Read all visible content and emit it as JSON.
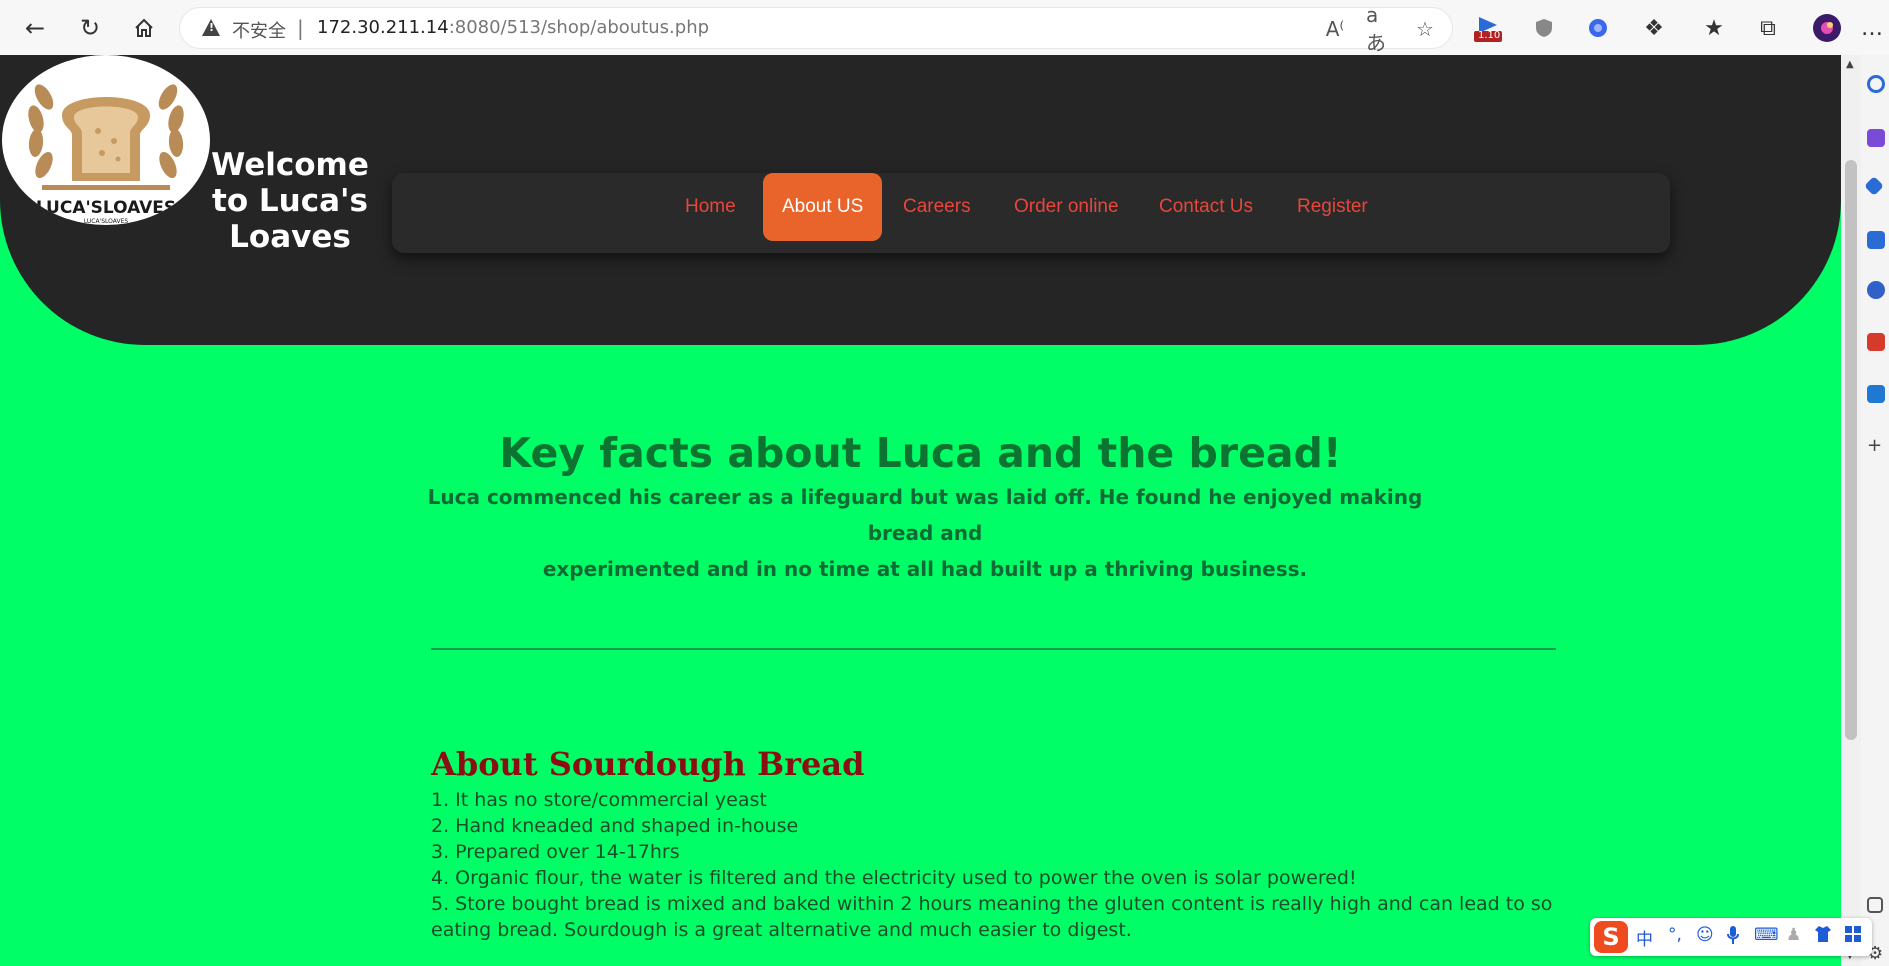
{
  "browser": {
    "insecure_label": "不安全",
    "separator": "|",
    "url_host": "172.30.211.14",
    "url_path": ":8080/513/shop/aboutus.php",
    "ext_badge": "1.10",
    "menu": "…"
  },
  "header": {
    "logo_brand": "LUCA'SLOAVES",
    "logo_sub": "LUCA'SLOAVES",
    "welcome_line1": "Welcome",
    "welcome_line2": "to Luca's",
    "welcome_line3": "Loaves"
  },
  "nav": {
    "items": [
      {
        "label": "Home"
      },
      {
        "label": "About US"
      },
      {
        "label": "Careers"
      },
      {
        "label": "Order online"
      },
      {
        "label": "Contact Us"
      },
      {
        "label": "Register"
      }
    ],
    "active": "About US"
  },
  "main": {
    "title": "Key facts about Luca and the bread!",
    "intro_line1": "Luca commenced his career as a lifeguard but was laid off. He found he enjoyed making bread and",
    "intro_line2": "experimented and in no time at all had built up a thriving business."
  },
  "sourdough": {
    "title": "About Sourdough Bread",
    "facts": [
      "1. It has no store/commercial yeast",
      "2. Hand kneaded and shaped in-house",
      "3. Prepared over 14-17hrs",
      "4. Organic flour, the water is filtered and the electricity used to power the oven is solar powered!",
      "5. Store bought bread is mixed and baked within 2 hours meaning the gluten content is really high and can lead to so",
      "eating bread. Sourdough is a great alternative and much easier to digest."
    ]
  },
  "ime": {
    "logo": "S",
    "mode": "中",
    "punct": "°,"
  },
  "colors": {
    "page_bg": "#00ff66",
    "header_bg": "#252525",
    "nav_link": "#e8463b",
    "nav_active_bg": "#e8642a",
    "title_green": "#0c7330",
    "section_red": "#8a0e12"
  }
}
